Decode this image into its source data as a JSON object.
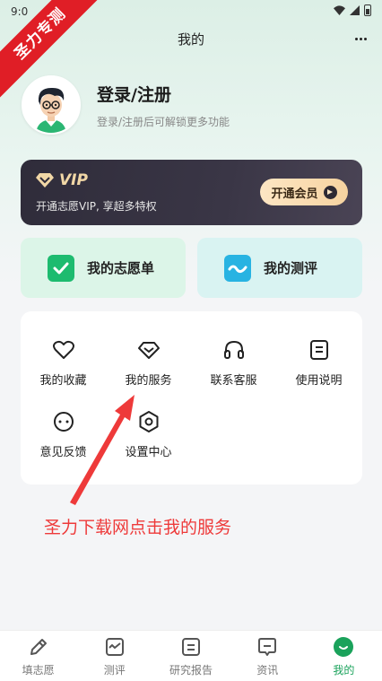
{
  "status_bar": {
    "time": "9:0"
  },
  "watermark": "圣力专测",
  "nav": {
    "title": "我的",
    "more_icon": "more-icon"
  },
  "profile": {
    "title": "登录/注册",
    "subtitle": "登录/注册后可解锁更多功能"
  },
  "vip": {
    "label": "VIP",
    "description": "开通志愿VIP, 享超多特权",
    "button_label": "开通会员"
  },
  "quick_actions": [
    {
      "label": "我的志愿单",
      "icon": "checklist-icon"
    },
    {
      "label": "我的测评",
      "icon": "pulse-icon"
    }
  ],
  "services": [
    {
      "label": "我的收藏",
      "icon": "heart-icon"
    },
    {
      "label": "我的服务",
      "icon": "diamond-icon"
    },
    {
      "label": "联系客服",
      "icon": "headset-icon"
    },
    {
      "label": "使用说明",
      "icon": "document-icon"
    },
    {
      "label": "意见反馈",
      "icon": "feedback-icon"
    },
    {
      "label": "设置中心",
      "icon": "settings-icon"
    }
  ],
  "promo_text": "圣力下载网点击我的服务",
  "tabs": [
    {
      "label": "填志愿",
      "icon": "pen-icon",
      "active": false
    },
    {
      "label": "测评",
      "icon": "chart-icon",
      "active": false
    },
    {
      "label": "研究报告",
      "icon": "report-icon",
      "active": false
    },
    {
      "label": "资讯",
      "icon": "message-icon",
      "active": false
    },
    {
      "label": "我的",
      "icon": "profile-icon",
      "active": true
    }
  ],
  "colors": {
    "accent_green": "#1aa25b",
    "vip_dark": "#2f2c3a",
    "vip_gold": "#f1d7a6",
    "promo_red": "#ee3a3a",
    "watermark_red": "#e01e26"
  }
}
